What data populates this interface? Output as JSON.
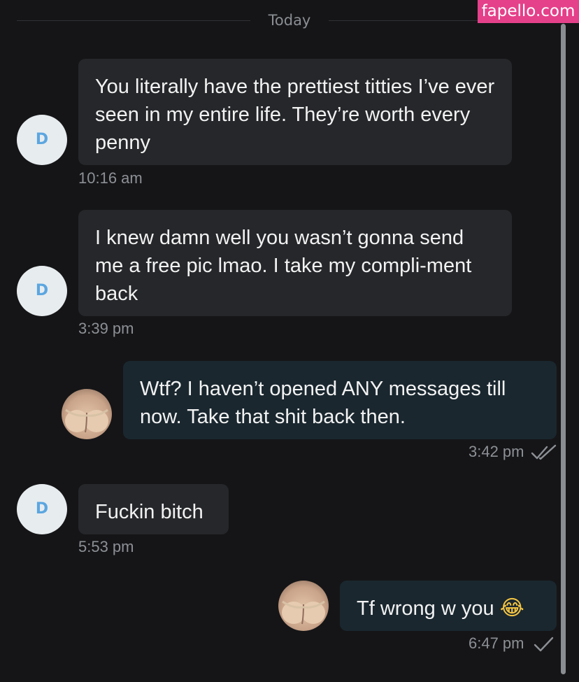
{
  "day_separator": "Today",
  "watermark": "fapello.com",
  "contact_initial": "D",
  "messages": [
    {
      "direction": "in",
      "text": "You literally have the prettiest titties I’ve ever seen in my entire life. They’re worth every penny",
      "time": "10:16 am"
    },
    {
      "direction": "in",
      "text": "I knew damn well you wasn’t gonna send me a free pic lmao. I take my compli-ment back",
      "time": "3:39 pm"
    },
    {
      "direction": "out",
      "text": "Wtf? I haven’t opened ANY messages till now. Take that shit back then.",
      "time": "3:42 pm",
      "status": "read"
    },
    {
      "direction": "in",
      "text": "Fuckin bitch",
      "time": "5:53 pm"
    },
    {
      "direction": "out",
      "text": "Tf wrong w you",
      "emoji": "😂",
      "time": "6:47 pm",
      "status": "sent"
    }
  ],
  "colors": {
    "background": "#151517",
    "incoming_bubble": "#25272a",
    "outgoing_bubble": "#1a272f",
    "timestamp": "#8c9095",
    "avatar_letter": "#5ba6e0",
    "watermark_bg": "#e5408a"
  },
  "icons": {
    "read_status": "double-check-icon",
    "sent_status": "single-check-icon"
  }
}
